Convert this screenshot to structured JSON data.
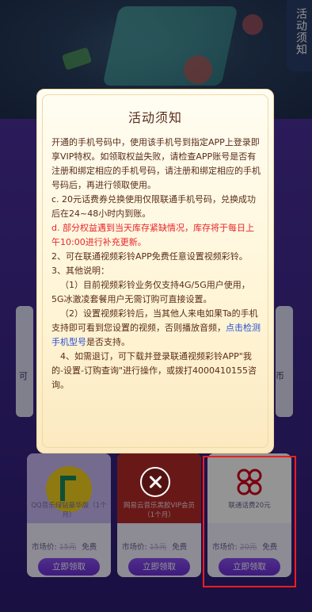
{
  "side_tab": {
    "label": "活动须知"
  },
  "side_cards": {
    "left_label": "可",
    "right_label": "币"
  },
  "products": [
    {
      "name": "QQ音乐绿钻豪华版（1个月）",
      "price_label": "市场价:",
      "original_price": "15元",
      "price_tag": "免费",
      "button": "立即领取",
      "icon": "qq-music-icon"
    },
    {
      "name": "网易云音乐黑胶VIP会员（1个月）",
      "price_label": "市场价:",
      "original_price": "15元",
      "price_tag": "免费",
      "button": "立即领取",
      "icon": "netease-cloud-music-icon"
    },
    {
      "name": "联通话费20元",
      "price_label": "市场价:",
      "original_price": "20元",
      "price_tag": "免费",
      "button": "立即领取",
      "icon": "china-unicom-icon"
    }
  ],
  "modal": {
    "title": "活动须知",
    "p1": "开通的手机号码中，使用该手机号到指定APP上登录即享VIP特权。如领取权益失败，请检查APP账号是否有注册和绑定相应的手机号码，请注册和绑定相应的手机号码后，再进行领取使用。",
    "p2": "c. 20元话费券兑换使用仅限联通手机号码，兑换成功后在24~48小时内到账。",
    "p3": "d. 部分权益遇到当天库存紧缺情况，库存将于每日上午10:00进行补充更新。",
    "p4": "2、可在联通视频彩铃APP免费任意设置视频彩铃。",
    "p5": "3、其他说明：",
    "p6": "（1）目前视频彩铃业务仅支持4G/5G用户使用，5G冰激凌套餐用户无需订购可直接设置。",
    "p7_a": "（2）设置视频彩铃后，当其他人来电如果Ta的手机支持即可看到您设置的视频，否则播放音频，",
    "p7_link": "点击检测手机型号",
    "p7_b": "是否支持。",
    "p8": "4、如需退订，可下载并登录联通视频彩铃APP\"我的-设置-订购查询\"进行操作，或拨打4000410155咨询。"
  },
  "colors": {
    "modal_text": "#5a2c18",
    "red_text": "#e8262c",
    "link": "#2b4fd8",
    "highlight_box": "#ee1d1d",
    "button": "#7a3ee6"
  }
}
